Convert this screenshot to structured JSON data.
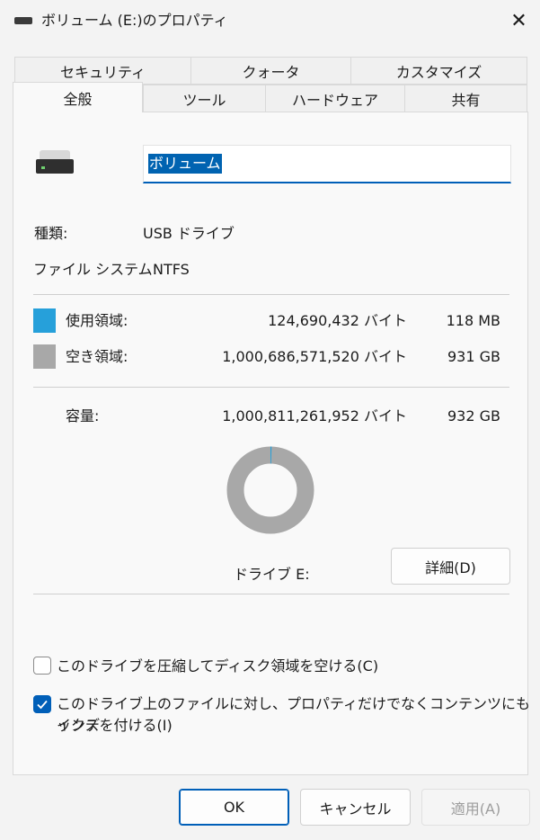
{
  "window": {
    "title": "ボリューム (E:)のプロパティ",
    "close_glyph": "✕"
  },
  "tabs": {
    "row_back": [
      "セキュリティ",
      "クォータ",
      "カスタマイズ"
    ],
    "row_front": [
      "全般",
      "ツール",
      "ハードウェア",
      "共有"
    ],
    "active": "全般"
  },
  "general": {
    "volume_name": "ボリューム",
    "type_label": "種類:",
    "type_value": "USB ドライブ",
    "fs_label": "ファイル システム:",
    "fs_value": "NTFS",
    "used_label": "使用領域:",
    "used_bytes": "124,690,432 バイト",
    "used_size": "118 MB",
    "free_label": "空き領域:",
    "free_bytes": "1,000,686,571,520 バイト",
    "free_size": "931 GB",
    "capacity_label": "容量:",
    "capacity_bytes": "1,000,811,261,952 バイト",
    "capacity_size": "932 GB",
    "drive_label": "ドライブ E:",
    "details_button": "詳細(D)",
    "used_fraction": 0.000125
  },
  "options": {
    "compress_label": "このドライブを圧縮してディスク領域を空ける(C)",
    "compress_checked": false,
    "index_label_line1": "このドライブ上のファイルに対し、プロパティだけでなくコンテンツにもインデ",
    "index_label_line2": "ックスを付ける(I)",
    "index_checked": true
  },
  "buttons": {
    "ok": "OK",
    "cancel": "キャンセル",
    "apply": "適用(A)"
  },
  "colors": {
    "used": "#26a0da",
    "free": "#a8a8a8",
    "accent": "#005fb8"
  }
}
